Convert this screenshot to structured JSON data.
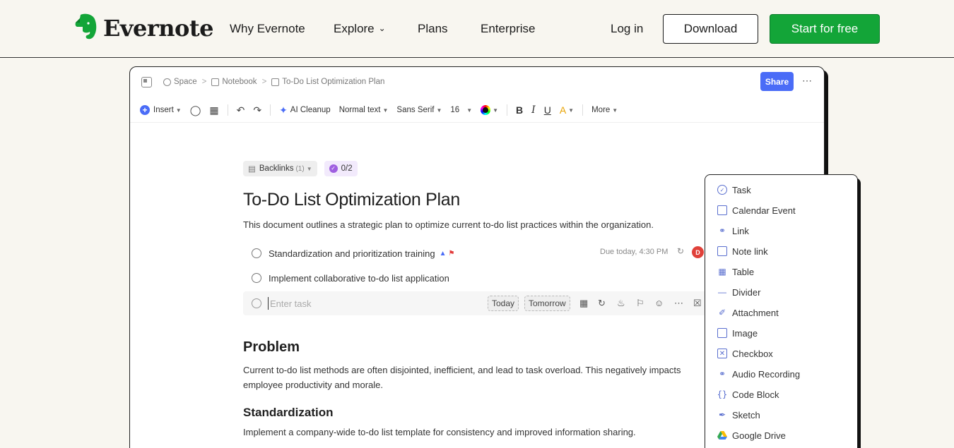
{
  "brand": {
    "name": "Evernote",
    "color": "#13a538"
  },
  "nav": {
    "why": "Why Evernote",
    "explore": "Explore",
    "plans": "Plans",
    "enterprise": "Enterprise",
    "login": "Log in",
    "download": "Download",
    "start": "Start for free"
  },
  "editor": {
    "breadcrumb": [
      "Space",
      "Notebook",
      "To-Do List Optimization Plan"
    ],
    "share": "Share",
    "toolbar": {
      "insert": "Insert",
      "ai_cleanup": "AI Cleanup",
      "text_style": "Normal text",
      "font": "Sans Serif",
      "size": "16",
      "more": "More"
    },
    "backlinks": "Backlinks",
    "backlinks_count": "(1)",
    "task_progress": "0/2",
    "title": "To-Do List Optimization Plan",
    "description": "This document outlines a strategic plan to optimize current to-do list practices within the organization.",
    "tasks": [
      {
        "label": "Standardization and prioritization training",
        "due": "Due today, 4:30 PM",
        "assignee": "D"
      },
      {
        "label": "Implement collaborative to-do list application"
      }
    ],
    "new_task": {
      "placeholder": "Enter task",
      "today": "Today",
      "tomorrow": "Tomorrow"
    },
    "problem_heading": "Problem",
    "problem_text": "Current to-do list methods are often disjointed, inefficient, and lead to task overload. This negatively impacts employee productivity and morale.",
    "standardization_heading": "Standardization",
    "standardization_text": "Implement a company-wide to-do list template for consistency and improved information sharing."
  },
  "insert_menu": [
    {
      "label": "Task",
      "icon": "check-circle-icon"
    },
    {
      "label": "Calendar Event",
      "icon": "calendar-icon"
    },
    {
      "label": "Link",
      "icon": "link-icon"
    },
    {
      "label": "Note link",
      "icon": "note-link-icon"
    },
    {
      "label": "Table",
      "icon": "table-icon"
    },
    {
      "label": "Divider",
      "icon": "divider-icon"
    },
    {
      "label": "Attachment",
      "icon": "paperclip-icon"
    },
    {
      "label": "Image",
      "icon": "image-icon"
    },
    {
      "label": "Checkbox",
      "icon": "checkbox-icon"
    },
    {
      "label": "Audio Recording",
      "icon": "microphone-icon"
    },
    {
      "label": "Code Block",
      "icon": "code-block-icon"
    },
    {
      "label": "Sketch",
      "icon": "sketch-icon"
    },
    {
      "label": "Google Drive",
      "icon": "google-drive-icon"
    }
  ]
}
